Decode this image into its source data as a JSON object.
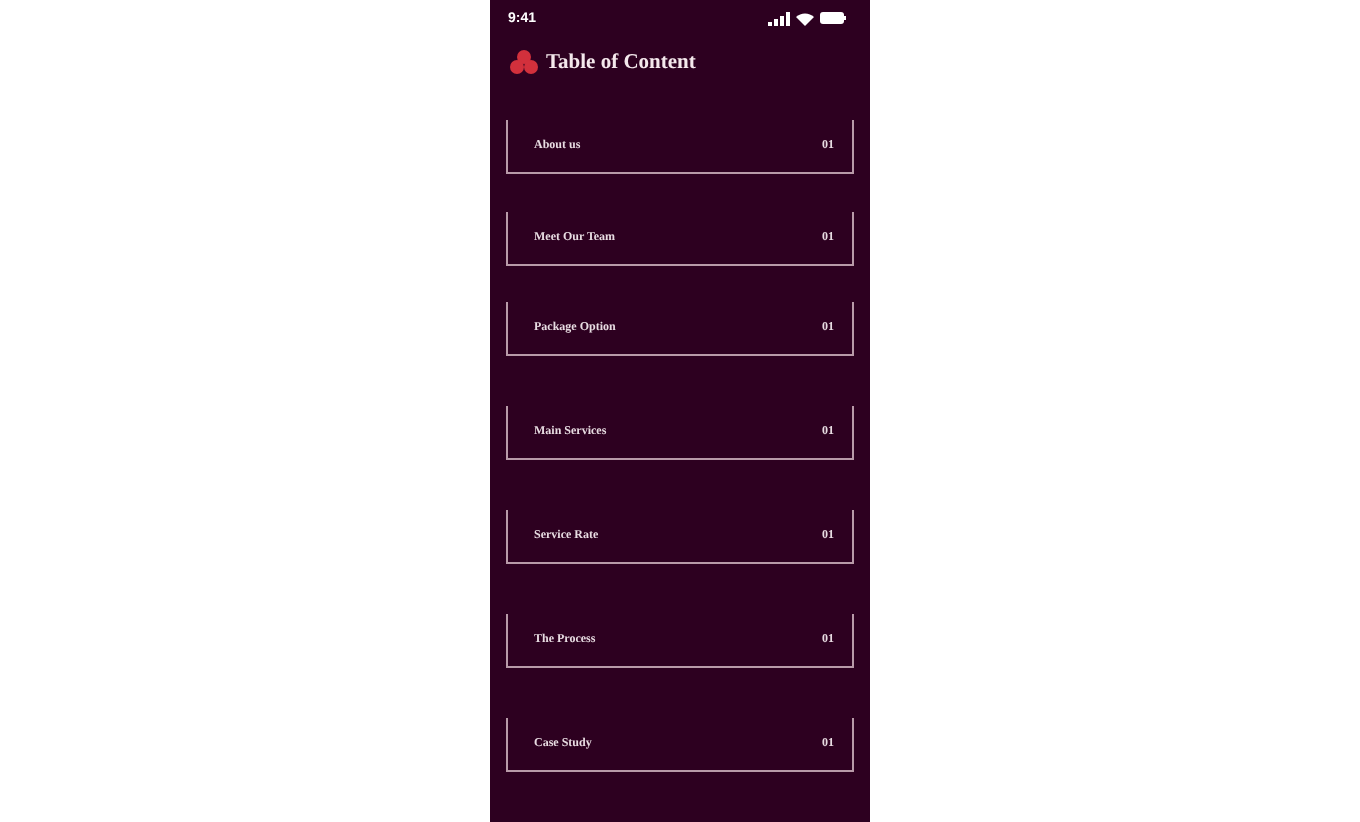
{
  "status_bar": {
    "time": "9:41"
  },
  "header": {
    "title": "Table of Content"
  },
  "items": [
    {
      "label": "About us",
      "number": "01"
    },
    {
      "label": "Meet Our Team",
      "number": "01"
    },
    {
      "label": "Package Option",
      "number": "01"
    },
    {
      "label": "Main Services",
      "number": "01"
    },
    {
      "label": "Service Rate",
      "number": "01"
    },
    {
      "label": "The Process",
      "number": "01"
    },
    {
      "label": "Case Study",
      "number": "01"
    }
  ]
}
